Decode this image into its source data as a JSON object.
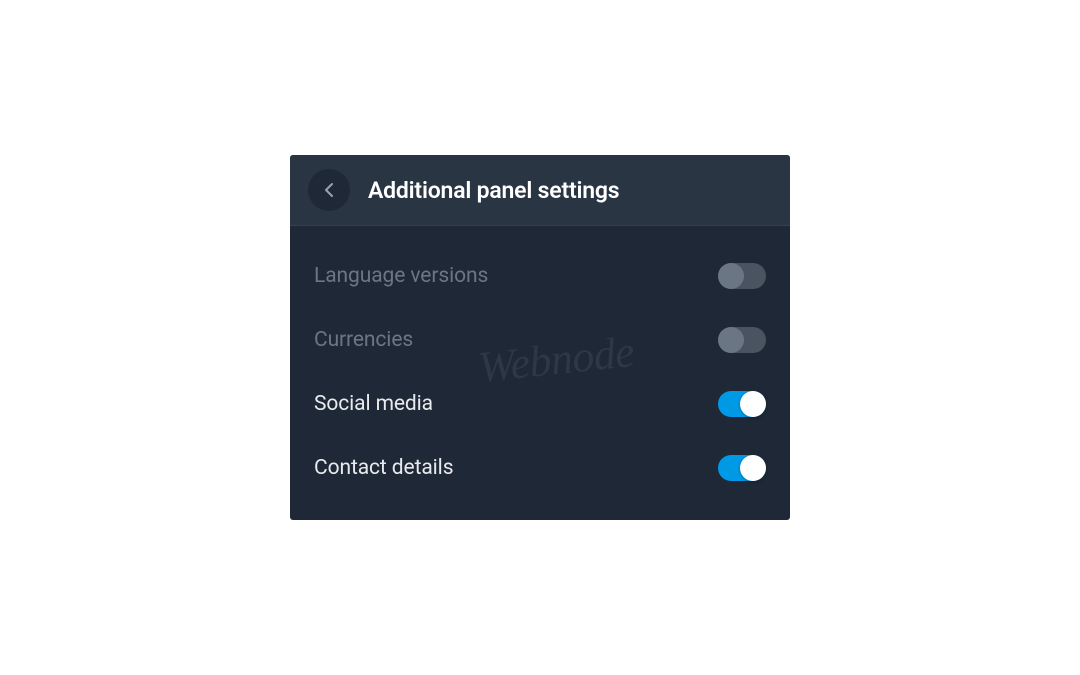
{
  "header": {
    "title": "Additional panel settings"
  },
  "settings": [
    {
      "label": "Language versions",
      "enabled": false
    },
    {
      "label": "Currencies",
      "enabled": false
    },
    {
      "label": "Social media",
      "enabled": true
    },
    {
      "label": "Contact details",
      "enabled": true
    }
  ],
  "watermark": "Webnode"
}
